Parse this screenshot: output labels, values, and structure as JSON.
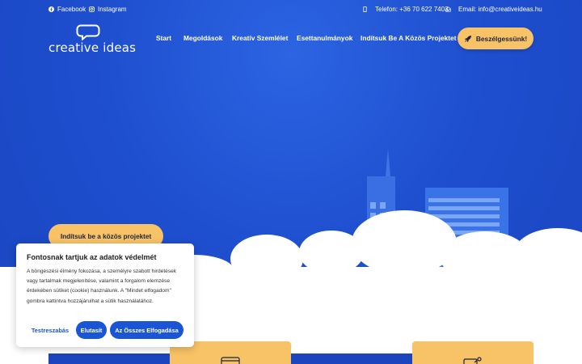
{
  "topbar": {
    "facebook": "Facebook",
    "instagram": "Instagram",
    "phone": "Telefon: +36 70 622 7403",
    "email": "Email: info@creativeideas.hu"
  },
  "logo": {
    "wordmark": "creative ideas"
  },
  "nav": {
    "items": [
      "Start",
      "Megoldások",
      "Kreatív Szemlélet",
      "Esettanulmányok",
      "Indítsuk Be A Közös Projektet"
    ],
    "cta": "Beszélgessünk!"
  },
  "hero": {
    "button": "Indítsuk be a közös projektet"
  },
  "cookie": {
    "title": "Fontosnak tartjuk az adatok védelmét",
    "text": "A böngészési élmény fokozása, a személyre szabott hirdetések vagy tartalmak megjelenítése, valamint a forgalom elemzése érdekében sütiket (cookie) használunk. A \"Mindet elfogadom\" gombra kattintva hozzájárulhat a sütik használatához.",
    "customize": "Testreszabás",
    "reject": "Elutasít",
    "accept": "Az Összes Elfogadása"
  },
  "colors": {
    "brand_blue": "#1f4fd0",
    "accent_yellow": "#f8c266",
    "button_blue": "#1a55d6"
  }
}
